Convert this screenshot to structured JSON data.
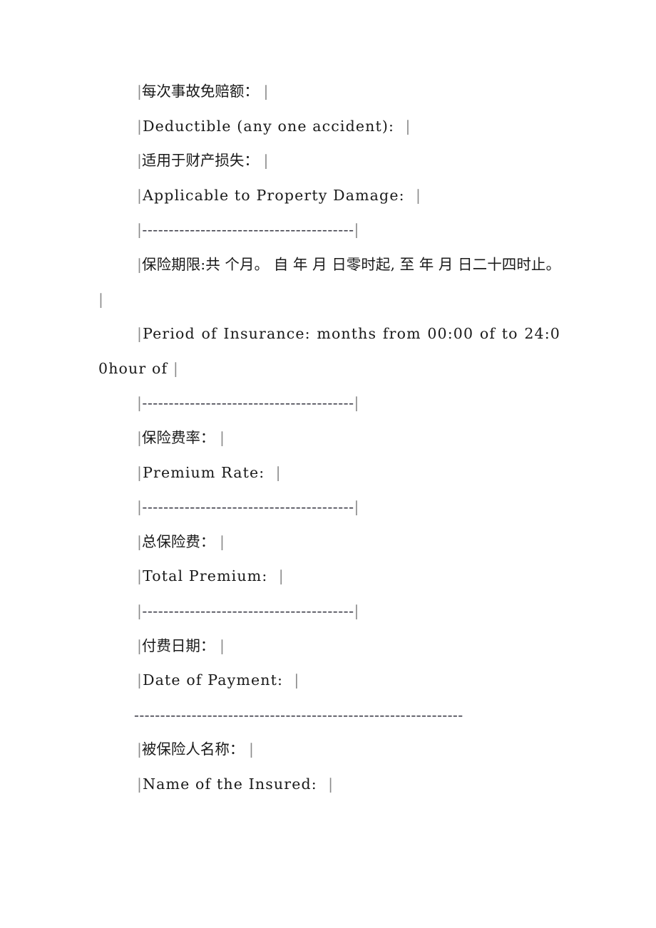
{
  "document": {
    "type": "insurance-policy-schedule-fragment",
    "language": "zh-CN + en",
    "background_color": "#ffffff",
    "text_color": "#1a1a1a",
    "delimiter_color": "#8a8a8a",
    "rule_color": "#3a3a46",
    "delimiter_char": "|",
    "rule_char": "-"
  },
  "lines": [
    {
      "id": "deductible-cn",
      "kind": "field-label-cn",
      "text": "|每次事故免赔额： |"
    },
    {
      "id": "deductible-en",
      "kind": "field-label-en",
      "text": "|Deductible (any one accident):  |"
    },
    {
      "id": "applicable-property-damage-cn",
      "kind": "field-label-cn",
      "text": "|适用于财产损失： |"
    },
    {
      "id": "applicable-property-damage-en",
      "kind": "field-label-en",
      "text": "|Applicable to Property Damage:  |"
    },
    {
      "id": "separator-1",
      "kind": "separator",
      "text": "|----------------------------------------|"
    },
    {
      "id": "period-of-insurance-cn",
      "kind": "field-value-cn",
      "text": "|保险期限:共 个月。 自 年 月 日零时起, 至 年 月 日二十四时止。 |"
    },
    {
      "id": "period-of-insurance-en",
      "kind": "field-value-en",
      "text": "|Period of Insurance: months from 00:00 of to 24:00hour of  |"
    },
    {
      "id": "separator-2",
      "kind": "separator",
      "text": "|----------------------------------------|"
    },
    {
      "id": "premium-rate-cn",
      "kind": "field-label-cn",
      "text": "|保险费率： |"
    },
    {
      "id": "premium-rate-en",
      "kind": "field-label-en",
      "text": "|Premium Rate:  |"
    },
    {
      "id": "separator-3",
      "kind": "separator",
      "text": "|----------------------------------------|"
    },
    {
      "id": "total-premium-cn",
      "kind": "field-label-cn",
      "text": "|总保险费： |"
    },
    {
      "id": "total-premium-en",
      "kind": "field-label-en",
      "text": "|Total Premium:  |"
    },
    {
      "id": "separator-4",
      "kind": "separator",
      "text": "|----------------------------------------|"
    },
    {
      "id": "date-of-payment-cn",
      "kind": "field-label-cn",
      "text": "|付费日期： |"
    },
    {
      "id": "date-of-payment-en",
      "kind": "field-label-en",
      "text": "|Date of Payment:  |"
    },
    {
      "id": "long-rule",
      "kind": "long-rule",
      "text": "---------------------------------------------------------------"
    },
    {
      "id": "name-of-insured-cn",
      "kind": "field-label-cn",
      "text": "|被保险人名称： |"
    },
    {
      "id": "name-of-insured-en",
      "kind": "field-label-en",
      "text": "|Name of the Insured:  |"
    }
  ]
}
